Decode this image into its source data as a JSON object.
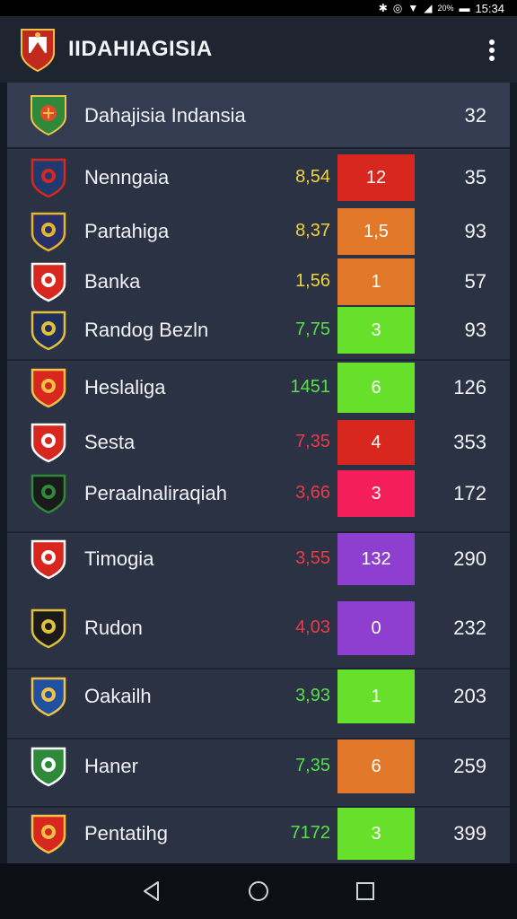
{
  "status_bar": {
    "battery_label": "20%",
    "time": "15:34"
  },
  "app_bar": {
    "title": "IIDAHIAGISIA"
  },
  "header": {
    "name": "Dahajisia Indansia",
    "points": "32"
  },
  "colors": {
    "red": "#d8271e",
    "orange": "#e2782a",
    "green": "#66e02a",
    "pink": "#f41f5a",
    "purple": "#8e3fd0",
    "stat_yellow": "#f0d43a",
    "stat_green": "#58e04a",
    "stat_red": "#ec3a4a"
  },
  "teams": [
    {
      "name": "Nenngaia",
      "stat": "8,54",
      "stat_color": "yellow",
      "badge": "12",
      "badge_color": "red",
      "points": "35",
      "icon": "shield-crest-icon"
    },
    {
      "name": "Partahiga",
      "stat": "8,37",
      "stat_color": "yellow",
      "badge": "1,5",
      "badge_color": "orange",
      "points": "93",
      "icon": "round-crest-icon"
    },
    {
      "name": "Banka",
      "stat": "1,56",
      "stat_color": "yellow",
      "badge": "1",
      "badge_color": "orange",
      "points": "57",
      "icon": "winged-crest-icon"
    },
    {
      "name": "Randog Bezln",
      "stat": "7,75",
      "stat_color": "green",
      "badge": "3",
      "badge_color": "green",
      "points": "93",
      "icon": "oval-crest-icon"
    },
    {
      "name": "Heslaliga",
      "stat": "1451",
      "stat_color": "green",
      "badge": "6",
      "badge_color": "green",
      "points": "126",
      "icon": "lyre-crest-icon"
    },
    {
      "name": "Sesta",
      "stat": "7,35",
      "stat_color": "red",
      "badge": "4",
      "badge_color": "red",
      "points": "353",
      "icon": "striped-crest-icon"
    },
    {
      "name": "Peraalnaliraqiah",
      "stat": "3,66",
      "stat_color": "red",
      "badge": "3",
      "badge_color": "pink",
      "points": "172",
      "icon": "banner-crest-icon"
    },
    {
      "name": "Timogia",
      "stat": "3,55",
      "stat_color": "red",
      "badge": "132",
      "badge_color": "purple",
      "points": "290",
      "icon": "sash-crest-icon"
    },
    {
      "name": "Rudon",
      "stat": "4,03",
      "stat_color": "red",
      "badge": "0",
      "badge_color": "purple",
      "points": "232",
      "icon": "star-crest-icon"
    },
    {
      "name": "Oakailh",
      "stat": "3,93",
      "stat_color": "green",
      "badge": "1",
      "badge_color": "green",
      "points": "203",
      "icon": "round-blue-crest-icon"
    },
    {
      "name": "Haner",
      "stat": "7,35",
      "stat_color": "green",
      "badge": "6",
      "badge_color": "orange",
      "points": "259",
      "icon": "green-crest-icon"
    },
    {
      "name": "Pentatihg",
      "stat": "7172",
      "stat_color": "green",
      "badge": "3",
      "badge_color": "green",
      "points": "399",
      "icon": "red-crest-icon"
    }
  ]
}
